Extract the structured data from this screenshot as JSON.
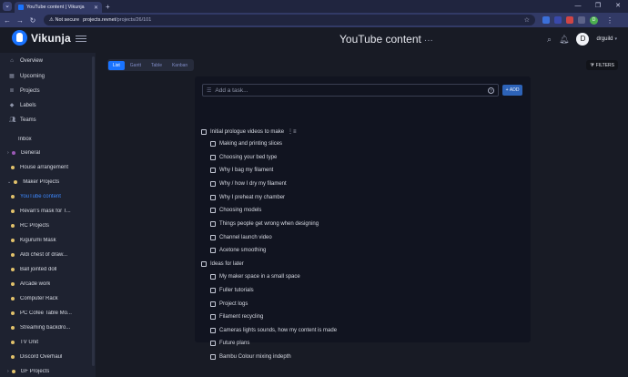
{
  "browser": {
    "tab_title": "YouTube content | Vikunja",
    "not_secure": "Not secure",
    "url_host": "projects.revnet",
    "url_path": "/projects/26/101",
    "profile_initial": "D"
  },
  "app": {
    "name": "Vikunja",
    "page_title": "YouTube content",
    "title_menu": "···",
    "user_initial": "D",
    "username": "drguild",
    "filters_label": "FILTERS"
  },
  "sidebar": {
    "nav": [
      {
        "label": "Overview",
        "icon": "home-icon"
      },
      {
        "label": "Upcoming",
        "icon": "calendar-icon"
      },
      {
        "label": "Projects",
        "icon": "layers-icon"
      },
      {
        "label": "Labels",
        "icon": "tag-icon"
      },
      {
        "label": "Teams",
        "icon": "users-icon"
      }
    ],
    "projects": [
      {
        "label": "Inbox"
      },
      {
        "label": "General"
      },
      {
        "label": "House arrangement"
      },
      {
        "label": "Maker Projects"
      },
      {
        "label": "YouTube content"
      },
      {
        "label": "Revan's mask for T..."
      },
      {
        "label": "RC Projects"
      },
      {
        "label": "Kigurumi Mask"
      },
      {
        "label": "Aldi chest of draw..."
      },
      {
        "label": "Ball jointed doll"
      },
      {
        "label": "Arcade work"
      },
      {
        "label": "Computer Rack"
      },
      {
        "label": "PC Cofee Table Mo..."
      },
      {
        "label": "Streaming backdro..."
      },
      {
        "label": "TV Unit"
      },
      {
        "label": "Discord Overhaul"
      },
      {
        "label": "GF Projects"
      }
    ],
    "colors": {
      "dot_yellow": "#e2c26b",
      "dot_purple": "#9b59b6",
      "active": "#3d88ff"
    }
  },
  "view_tabs": [
    {
      "label": "List",
      "active": true
    },
    {
      "label": "Gantt",
      "active": false
    },
    {
      "label": "Table",
      "active": false
    },
    {
      "label": "Kanban",
      "active": false
    }
  ],
  "add_task": {
    "placeholder": "Add a task...",
    "button_label": "ADD",
    "help": "?"
  },
  "tasks": [
    {
      "title": "Initial prologue videos to make",
      "done": false,
      "has_subtasks": true,
      "subtasks": [
        {
          "title": "Making and printing slices"
        },
        {
          "title": "Choosing your bed type"
        },
        {
          "title": "Why I bag my filament"
        },
        {
          "title": "Why / how I dry my filament"
        },
        {
          "title": "Why I preheat my chamber"
        },
        {
          "title": "Choosing models"
        },
        {
          "title": "Things people get wrong when designing"
        },
        {
          "title": "Channel launch video"
        },
        {
          "title": "Acetone smoothing"
        }
      ]
    },
    {
      "title": "Ideas for later",
      "done": false,
      "has_subtasks": false,
      "subtasks": [
        {
          "title": "My maker space in a small space"
        },
        {
          "title": "Fuller tutorials"
        },
        {
          "title": "Project logs"
        },
        {
          "title": "Filament recycling"
        },
        {
          "title": "Cameras lights sounds, how my content is made"
        },
        {
          "title": "Future plans"
        },
        {
          "title": "Bambu Colour mixing indepth"
        }
      ]
    }
  ],
  "colors": {
    "accent": "#1973ff",
    "background": "#181b25",
    "sidebar": "#1e2230",
    "panel": "#111420"
  }
}
